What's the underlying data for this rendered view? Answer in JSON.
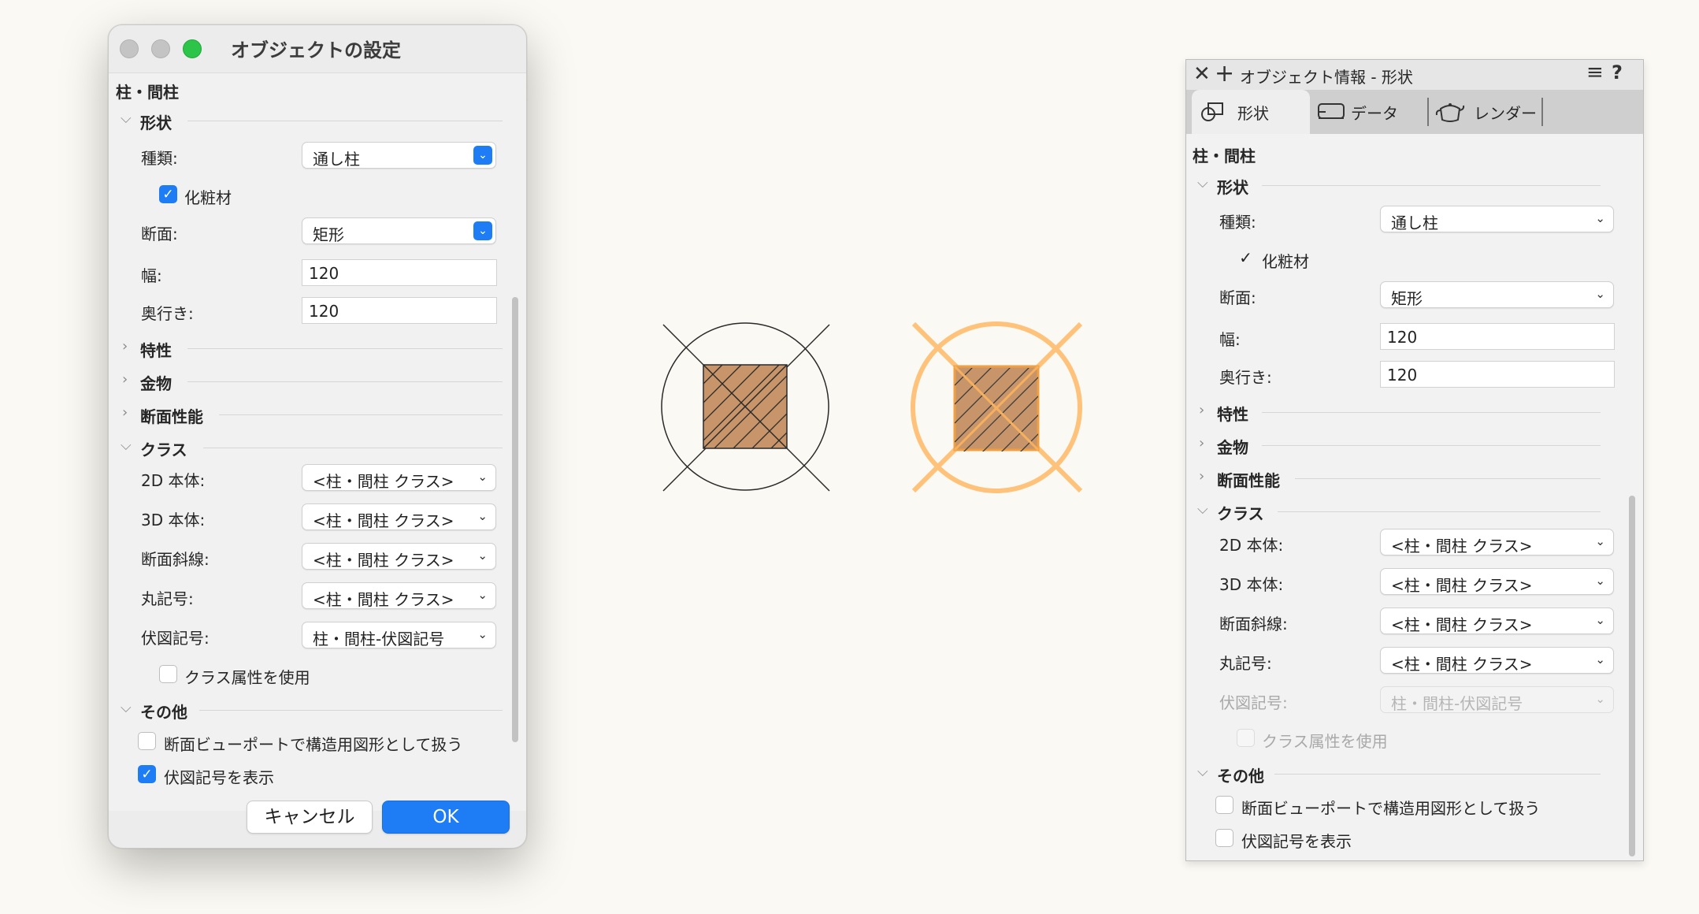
{
  "dialog": {
    "title": "オブジェクトの設定",
    "object_type": "柱・間柱",
    "sections": {
      "shape": "形状",
      "properties": "特性",
      "hardware": "金物",
      "section_performance": "断面性能",
      "class": "クラス",
      "other": "その他"
    },
    "fields": {
      "type_label": "種類:",
      "type_value": "通し柱",
      "finish_label": "化粧材",
      "section_label": "断面:",
      "section_value": "矩形",
      "width_label": "幅:",
      "width_value": "120",
      "depth_label": "奥行き:",
      "depth_value": "120"
    },
    "class_fields": [
      {
        "label": "2D 本体:",
        "value": "<柱・間柱 クラス>"
      },
      {
        "label": "3D 本体:",
        "value": "<柱・間柱 クラス>"
      },
      {
        "label": "断面斜線:",
        "value": "<柱・間柱 クラス>"
      },
      {
        "label": "丸記号:",
        "value": "<柱・間柱 クラス>"
      },
      {
        "label": "伏図記号:",
        "value": "柱・間柱-伏図記号"
      }
    ],
    "use_class_attr": "クラス属性を使用",
    "other_options": {
      "structural": "断面ビューポートで構造用図形として扱う",
      "show_plan_symbol": "伏図記号を表示"
    },
    "buttons": {
      "cancel": "キャンセル",
      "ok": "OK"
    }
  },
  "panel": {
    "title": "オブジェクト情報 - 形状",
    "tabs": [
      "形状",
      "データ",
      "レンダー"
    ],
    "object_type": "柱・間柱",
    "sections": {
      "shape": "形状",
      "properties": "特性",
      "hardware": "金物",
      "section_performance": "断面性能",
      "class": "クラス",
      "other": "その他"
    },
    "fields": {
      "type_label": "種類:",
      "type_value": "通し柱",
      "finish_label": "化粧材",
      "section_label": "断面:",
      "section_value": "矩形",
      "width_label": "幅:",
      "width_value": "120",
      "depth_label": "奥行き:",
      "depth_value": "120"
    },
    "class_fields": [
      {
        "label": "2D 本体:",
        "value": "<柱・間柱 クラス>"
      },
      {
        "label": "3D 本体:",
        "value": "<柱・間柱 クラス>"
      },
      {
        "label": "断面斜線:",
        "value": "<柱・間柱 クラス>"
      },
      {
        "label": "丸記号:",
        "value": "<柱・間柱 クラス>"
      },
      {
        "label": "伏図記号:",
        "value": "柱・間柱-伏図記号"
      }
    ],
    "use_class_attr": "クラス属性を使用",
    "other_options": {
      "structural": "断面ビューポートで構造用図形として扱う",
      "show_plan_symbol": "伏図記号を表示"
    }
  },
  "colors": {
    "accent": "#1e7cf4",
    "column_fill": "#c8956a",
    "highlight": "#ffc27a"
  }
}
